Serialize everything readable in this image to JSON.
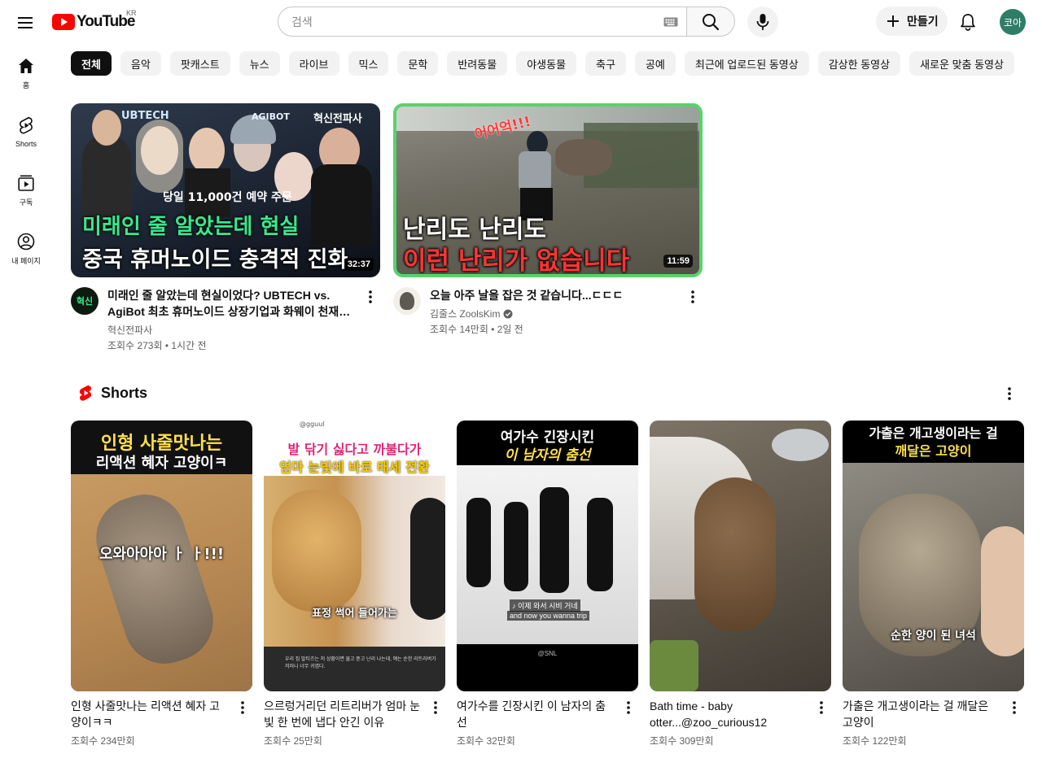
{
  "header": {
    "logo_text": "YouTube",
    "country_code": "KR",
    "search_placeholder": "검색",
    "create_label": "만들기",
    "avatar_text": "코아"
  },
  "sidebar": {
    "items": [
      {
        "label": "홈",
        "icon": "home-icon"
      },
      {
        "label": "Shorts",
        "icon": "shorts-icon"
      },
      {
        "label": "구독",
        "icon": "subscriptions-icon"
      },
      {
        "label": "내 페이지",
        "icon": "account-icon"
      }
    ]
  },
  "chips": [
    "전체",
    "음악",
    "팟캐스트",
    "뉴스",
    "라이브",
    "믹스",
    "문학",
    "반려동물",
    "야생동물",
    "축구",
    "공예",
    "최근에 업로드된 동영상",
    "감상한 동영상",
    "새로운 맞춤 동영상"
  ],
  "videos": [
    {
      "title": "미래인 줄 알았는데 현실이었다? UBTECH vs. AgiBot 최초 휴머노이드 상장기업과 화웨이 천재소...",
      "channel": "혁신전파사",
      "channel_avatar_text": "혁신",
      "stats": "조회수 273회 • 1시간 전",
      "duration": "32:37",
      "thumb_top": "당일 11,000건 예약 주문",
      "thumb_line1": "미래인 줄 알았는데 현실",
      "thumb_line2": "중국 휴머노이드 충격적 진화",
      "thumb_brand1": "UBTECH",
      "thumb_brand2": "AGIBOT",
      "thumb_brand3": "혁신전파사",
      "verified": false
    },
    {
      "title": "오늘 아주 날을 잡은 것 같습니다...ㄷㄷㄷ",
      "channel": "김줄스 ZoolsKim",
      "stats": "조회수 14만회 • 2일 전",
      "duration": "11:59",
      "thumb_top": "어어억!!!",
      "thumb_line1": "난리도 난리도",
      "thumb_line2": "이런 난리가 없습니다",
      "verified": true
    }
  ],
  "shorts_section": {
    "title": "Shorts",
    "items": [
      {
        "title": "인형 사줄맛나는 리액션 혜자 고양이ㅋㅋ",
        "views": "조회수 234만회",
        "ov1": "인형 사줄맛나는",
        "ov2": "리액션 혜자 고양이ㅋ",
        "ov3": "오와아아아 ㅏ ㅏ!!!"
      },
      {
        "title": "으르렁거리던 리트리버가 엄마 눈빛 한 번에 냅다 안긴 이유",
        "views": "조회수 25만회",
        "ov0": "@gguul",
        "ov1": "발 닦기 싫다고 까불다가",
        "ov2": "엄마 눈빛에 바로 태세 전환",
        "ov3": "표정 썩어 들어가는",
        "ov4": "우리 집 말티즈는 저 상황이면 물고 뜯고 난리 나는데, 얘는 순한 리트리버가 저러니 너무 귀엽다."
      },
      {
        "title": "여가수를 긴장시킨 이 남자의 춤선",
        "views": "조회수 32만회",
        "ov1": "여가수 긴장시킨",
        "ov2": "이 남자의 춤선",
        "ov3": "♪ 이제 와서 시비 거네",
        "ov4": "and now you wanna trip",
        "ov5": "@SNL"
      },
      {
        "title": "Bath time - baby otter...@zoo_curious12",
        "views": "조회수 309만회"
      },
      {
        "title": "가출은 개고생이라는 걸 깨달은 고양이",
        "views": "조회수 122만회",
        "ov1": "가출은 개고생이라는 걸",
        "ov2": "깨달은 고양이",
        "ov3": "순한 양이 된 녀석"
      }
    ]
  },
  "colors": {
    "youtube_red": "#ff0000",
    "chip_active": "#0f0f0f",
    "chip_bg": "#f2f2f2",
    "secondary_text": "#606060",
    "avatar_bg": "#2e7d67",
    "thumb_green_border": "#57d36b"
  }
}
